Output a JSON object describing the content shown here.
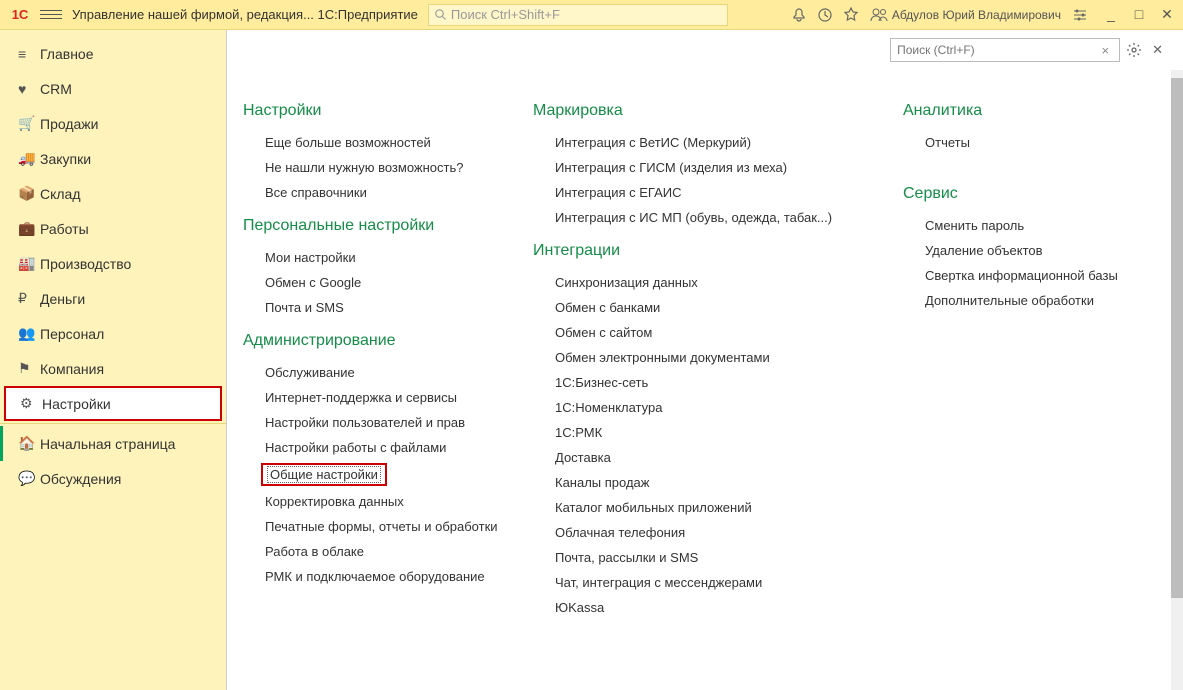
{
  "titlebar": {
    "logo_text": "1C",
    "app_title": "Управление нашей фирмой, редакция...  1С:Предприятие",
    "search_placeholder": "Поиск Ctrl+Shift+F",
    "user_name": "Абдулов Юрий Владимирович"
  },
  "sidebar": {
    "items": [
      {
        "label": "Главное"
      },
      {
        "label": "CRM"
      },
      {
        "label": "Продажи"
      },
      {
        "label": "Закупки"
      },
      {
        "label": "Склад"
      },
      {
        "label": "Работы"
      },
      {
        "label": "Производство"
      },
      {
        "label": "Деньги"
      },
      {
        "label": "Персонал"
      },
      {
        "label": "Компания"
      },
      {
        "label": "Настройки"
      },
      {
        "label": "Начальная страница"
      },
      {
        "label": "Обсуждения"
      }
    ]
  },
  "content": {
    "search_placeholder": "Поиск (Ctrl+F)",
    "groups": {
      "settings": {
        "title": "Настройки",
        "items": [
          "Еще больше возможностей",
          "Не нашли нужную возможность?",
          "Все справочники"
        ]
      },
      "personal": {
        "title": "Персональные настройки",
        "items": [
          "Мои настройки",
          "Обмен с Google",
          "Почта и SMS"
        ]
      },
      "admin": {
        "title": "Администрирование",
        "items": [
          "Обслуживание",
          "Интернет-поддержка и сервисы",
          "Настройки пользователей и прав",
          "Настройки работы с файлами",
          "Общие настройки",
          "Корректировка данных",
          "Печатные формы, отчеты и обработки",
          "Работа в облаке",
          "РМК и подключаемое оборудование"
        ]
      },
      "marking": {
        "title": "Маркировка",
        "items": [
          "Интеграция с ВетИС (Меркурий)",
          "Интеграция с ГИСМ (изделия из меха)",
          "Интеграция с ЕГАИС",
          "Интеграция с ИС МП (обувь, одежда, табак...)"
        ]
      },
      "integrations": {
        "title": "Интеграции",
        "items": [
          "Синхронизация данных",
          "Обмен с банками",
          "Обмен с сайтом",
          "Обмен электронными документами",
          "1С:Бизнес-сеть",
          "1С:Номенклатура",
          "1С:РМК",
          "Доставка",
          "Каналы продаж",
          "Каталог мобильных приложений",
          "Облачная телефония",
          "Почта, рассылки и SMS",
          "Чат, интеграция с мессенджерами",
          "ЮKassa"
        ]
      },
      "analytics": {
        "title": "Аналитика",
        "items": [
          "Отчеты"
        ]
      },
      "service": {
        "title": "Сервис",
        "items": [
          "Сменить пароль",
          "Удаление объектов",
          "Свертка информационной базы",
          "Дополнительные обработки"
        ]
      }
    }
  }
}
